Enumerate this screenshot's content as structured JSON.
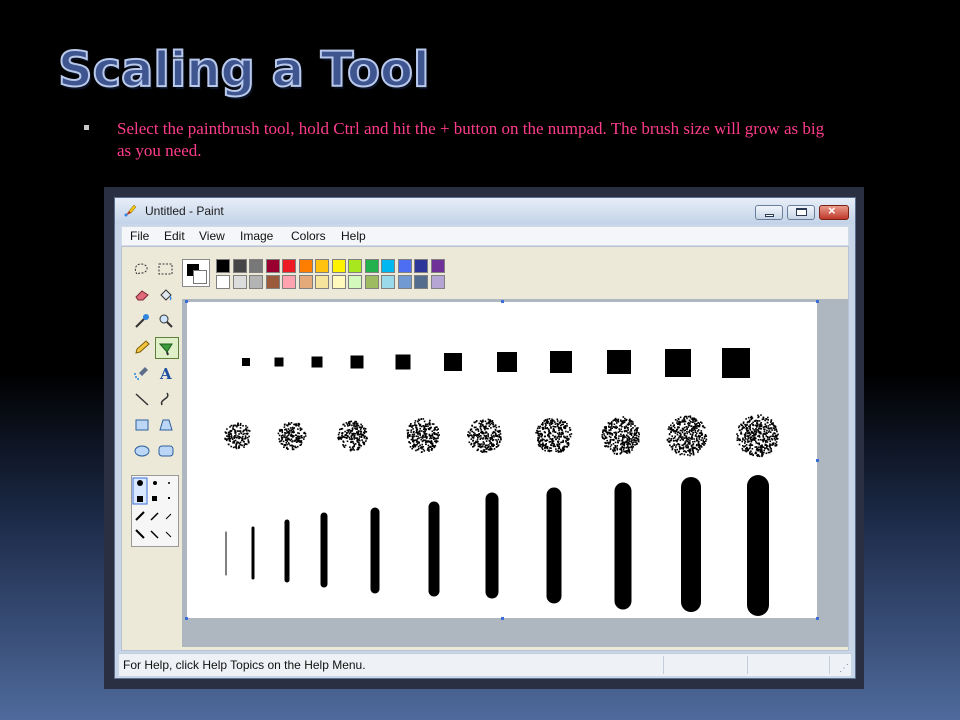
{
  "slide": {
    "title": "Scaling a Tool",
    "bullet": "Select the paintbrush tool, hold Ctrl and hit the + button on the numpad. The brush size will grow as big as you need."
  },
  "window": {
    "title": "Untitled - Paint",
    "menu": [
      "File",
      "Edit",
      "View",
      "Image",
      "Colors",
      "Help"
    ],
    "status": "For Help, click Help Topics on the Help Menu."
  },
  "tools": [
    "free-form-select-icon",
    "select-icon",
    "eraser-icon",
    "fill-icon",
    "color-picker-icon",
    "magnifier-icon",
    "pencil-icon",
    "brush-icon",
    "airbrush-icon",
    "text-icon",
    "line-icon",
    "curve-icon",
    "rectangle-icon",
    "polygon-icon",
    "ellipse-icon",
    "rounded-rectangle-icon"
  ],
  "palette": {
    "top": [
      "#000000",
      "#464646",
      "#787878",
      "#990030",
      "#ed1c24",
      "#ff7e00",
      "#ffc20e",
      "#fff200",
      "#a8e61d",
      "#22b14c",
      "#00b7ef",
      "#4d6df3",
      "#2f3699",
      "#6f3198"
    ],
    "bottom": [
      "#ffffff",
      "#dcdcdc",
      "#b4b4b4",
      "#9c5a3c",
      "#ffa3b1",
      "#e5aa7a",
      "#f5e49c",
      "#fff9bd",
      "#d3f9bc",
      "#9dbb61",
      "#99d9ea",
      "#709ad1",
      "#546d8e",
      "#b5a5d5"
    ]
  },
  "colors": {
    "foreground": "#000000",
    "background": "#ffffff"
  }
}
